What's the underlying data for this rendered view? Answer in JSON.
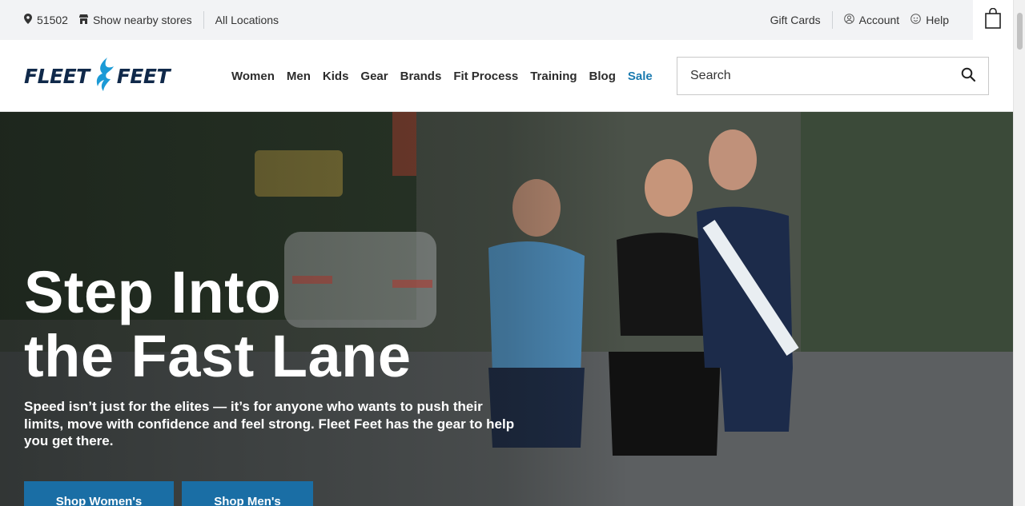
{
  "utility_bar": {
    "zip": "51502",
    "nearby_stores": "Show nearby stores",
    "all_locations": "All Locations",
    "gift_cards": "Gift Cards",
    "account": "Account",
    "help": "Help"
  },
  "header": {
    "logo_word_1": "FLEET",
    "logo_word_2": "FEET",
    "nav": [
      "Women",
      "Men",
      "Kids",
      "Gear",
      "Brands",
      "Fit Process",
      "Training",
      "Blog",
      "Sale"
    ],
    "search_placeholder": "Search"
  },
  "hero": {
    "title_line_1": "Step Into",
    "title_line_2": "the Fast Lane",
    "subtitle": "Speed isn’t just for the elites — it’s for anyone who wants to push their limits, move with confidence and feel strong. Fleet Feet has the gear to help you get there.",
    "buttons": [
      "Shop Women's",
      "Shop Men's"
    ]
  },
  "colors": {
    "brand_navy": "#10294a",
    "brand_blue": "#1b9ad6",
    "sale_link": "#1b7bb0",
    "cta_button": "#1a6ea5",
    "utility_bg": "#f2f3f5"
  },
  "icons": [
    "location-pin-icon",
    "store-icon",
    "account-icon",
    "help-icon",
    "shopping-bag-icon",
    "search-icon",
    "logo-flame-icon"
  ]
}
